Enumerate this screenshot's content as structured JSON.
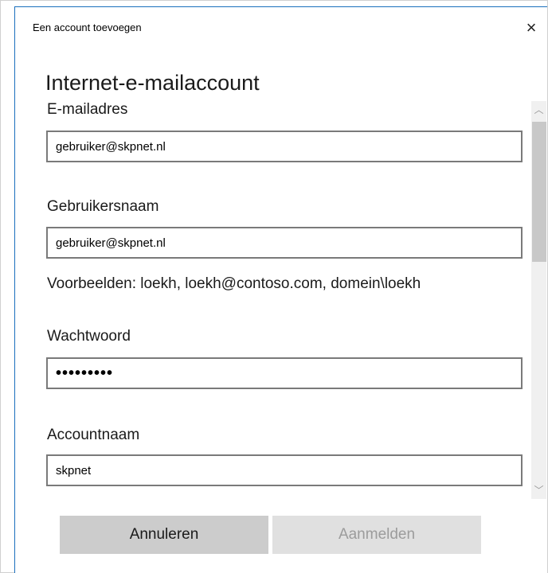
{
  "window": {
    "title": "Een account toevoegen",
    "close_icon": "×"
  },
  "page": {
    "heading": "Internet-e-mailaccount"
  },
  "form": {
    "email": {
      "label": "E-mailadres",
      "value": "gebruiker@skpnet.nl"
    },
    "username": {
      "label": "Gebruikersnaam",
      "value": "gebruiker@skpnet.nl",
      "hint": "Voorbeelden: loekh, loekh@contoso.com, domein\\loekh"
    },
    "password": {
      "label": "Wachtwoord",
      "masked_value": "•••••••••"
    },
    "account_name": {
      "label": "Accountnaam",
      "value": "skpnet"
    }
  },
  "scrollbar": {
    "up_icon": "︿",
    "down_icon": "﹀"
  },
  "buttons": {
    "cancel_label": "Annuleren",
    "signin_label": "Aanmelden"
  },
  "colors": {
    "accent_border": "#1a6fbd",
    "button_bg": "#cccccc",
    "button_disabled_bg": "#e0e0e0",
    "button_disabled_text": "#9c9c9c"
  }
}
